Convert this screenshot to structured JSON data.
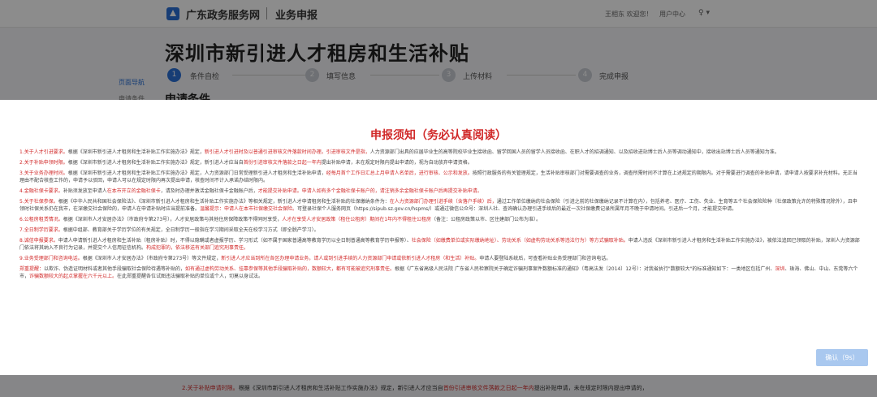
{
  "header": {
    "site_name": "广东政务服务网",
    "section": "业务申报",
    "welcome": "王相东 欢迎您！",
    "user_center": "用户中心",
    "user_icon": "♀ ▾"
  },
  "page": {
    "title": "深圳市新引进人才租房和生活补贴",
    "side_nav_label": "页面导航",
    "side_nav_item": "申请条件",
    "section_title": "申请条件",
    "steps": [
      {
        "num": "1",
        "label": "条件自检"
      },
      {
        "num": "2",
        "label": "填写信息"
      },
      {
        "num": "3",
        "label": "上传材料"
      },
      {
        "num": "4",
        "label": "完成申报"
      }
    ]
  },
  "modal": {
    "title": "申报须知（务必认真阅读）",
    "items": [
      {
        "parts": [
          {
            "t": "1.关于人才引进要求。",
            "red": true
          },
          {
            "t": "根据《深圳市新引进人才租房和生活补贴工作实施办法》规定，",
            "red": false
          },
          {
            "t": "新引进人才引进时及以普通引进审核文件落款时间办理。引进审核文件是指，",
            "red": true
          },
          {
            "t": "人力资源部门出具的应届毕业生的高等院校毕业生接收函、留学回国人员的留学人员接收函、在职人才的招调通知、以及招收进站博士后人员等调动通知中，接收出站博士后人员等通知为准。",
            "red": false
          }
        ]
      },
      {
        "parts": [
          {
            "t": "2.关于补贴申领时限。",
            "red": true
          },
          {
            "t": "根据《深圳市新引进人才租房和生活补贴工作实施办法》规定，新引进人才应当自",
            "red": false
          },
          {
            "t": "首份引进审核文件落款之日起一年内",
            "red": true
          },
          {
            "t": "提出补贴申请，未在规定时限内提出申请的，视为自动放弃申请资格。",
            "red": false
          }
        ]
      },
      {
        "parts": [
          {
            "t": "3.关于业务办理时间。",
            "red": true
          },
          {
            "t": "根据《深圳市新引进人才租房和生活补贴工作实施办法》规定，人力资源部门日常受理新引进人才租房和生活补贴申请，",
            "red": false
          },
          {
            "t": "经每月首个工作日汇总上月申请人名单后，进行审核、公示和发放。",
            "red": true
          },
          {
            "t": "按照行政服务的有关管理规定，生活补贴审核部门对需要调查的业务，调查所需时间不计算在上述规定的期限内。对于需要进行调查的补贴申请，请申请人按要求补充材料。",
            "red": false
          },
          {
            "t": "无正当理由不配合核查工作的，申请予以驳回，申请人可以在规定时限内再次提出申请，核查时间不计入承诺办结时限内。",
            "red": false
          }
        ]
      },
      {
        "parts": [
          {
            "t": "4.金融社保卡要求。",
            "red": true
          },
          {
            "t": "补贴须发放至申请人",
            "red": false
          },
          {
            "t": "在本市开立的金融社保卡",
            "red": true
          },
          {
            "t": "，请及时办理并激活金融社保卡金融账户后，",
            "red": false
          },
          {
            "t": "才能提交补贴申请。申请人如有多个金融社保卡账户的，请注销多余金融社保卡账户后再提交补贴申请。",
            "red": true
          }
        ]
      },
      {
        "parts": [
          {
            "t": "5.关于社保参保。",
            "red": true
          },
          {
            "t": "根据《中华人民共和国社会保险法》、《深圳市新引进人才租房和生活补贴工作实施办法》等相关规定，新引进人才申请租房和生活补贴的社保缴纳条件为：",
            "red": false
          },
          {
            "t": "在人力资源部门办理引进手续（含落户手续）后，",
            "red": true
          },
          {
            "t": "通过工作单位缴纳的社会保险（引进之前的社保缴纳记录不计算在内），包括养老、医疗、工伤、失业、生育等五个社会保险险种（社保政策允许的特殊情况除外），且申领时社保关系仍在我市，在深缴交社会保险的，申请人在申请补贴时应当提前准备。",
            "red": false
          },
          {
            "t": "温馨提示：申请人在本市社保缴交社会保险。",
            "red": true
          },
          {
            "t": "可登录社保个人服务网页（https://sipub.sz.gov.cn/hspms/）或通过微信公众号：深圳人社、查询确认办理引进手续后的最近一次社保缴费记录所属年月不晚于申请时间。引进后一个月，才能提交申请。",
            "red": false
          }
        ]
      },
      {
        "parts": [
          {
            "t": "6.公租房租赁情况。",
            "red": true
          },
          {
            "t": "根据《深圳市人才安居办法》（市政府令第273号），人才安居政策与其他住房保障政策不得同时享受，",
            "red": false
          },
          {
            "t": "人才在享受人才安居政策（租住公租房）期间在1年内不得租住公租房",
            "red": true
          },
          {
            "t": "（备注：公租房政策以市、区住建部门公布为准）。",
            "red": false
          }
        ]
      },
      {
        "parts": [
          {
            "t": "7.全日制学历要求。",
            "red": true
          },
          {
            "t": "根据中组部、教育部关于学历学位的有关规定，全日制学历一般指在学习期间采取全天在校学习方式（即全脱产学习）。",
            "red": false
          }
        ]
      },
      {
        "parts": [
          {
            "t": "8.诚信申报要求。",
            "red": true
          },
          {
            "t": "申请人申请新引进人才租房和生活补贴（租房补贴）时，不得以隐瞒或者虚报学历、学习形式（如不属于国家普通高等教育学历以全日制普通高等教育学历申报等）、",
            "red": false
          },
          {
            "t": "社会保险（如缴费单位或实际缴纳地址）、劳动关系（如虚构劳动关系等违法行为）等方式骗取补贴。",
            "red": true
          },
          {
            "t": "申请人违反《深圳市新引进人才租房和生活补贴工作实施办法》，被依法追回已领取的补贴，深圳人力资源部门依法将其纳入不良行为记录，并提交个人信用征信机构。",
            "red": false
          },
          {
            "t": "构成犯罪的，依法移送有关部门追究刑事责任。",
            "red": true
          }
        ]
      },
      {
        "parts": [
          {
            "t": "9.业务受理部门和咨询电话。",
            "red": true
          },
          {
            "t": "根据《深圳市人才安居办法》（市政府令第273号）等文件规定，",
            "red": false
          },
          {
            "t": "新引进人才应当到所在各区办理申请业务，请人或到引进手续的人力资源部门申请或依新引进人才租房（和生活）补贴。",
            "red": true
          },
          {
            "t": "申请人要登陆系统后，可查看补贴业务受理部门和咨询电话。",
            "red": false
          }
        ]
      },
      {
        "parts": [
          {
            "t": "郑重提醒：",
            "red": true
          },
          {
            "t": "以欺诈、伪造证明材料或者其他手段骗取社会保险待遇等补贴的，",
            "red": false
          },
          {
            "t": "如有通过虚构劳动关系、挂靠参保等其他手段骗取补贴的，数额较大，都有可能被追究刑事责任。",
            "red": true
          },
          {
            "t": "根据《广东省高级人民法院 广东省人民检察院关于确定诈骗刑事案件数额标准的通知》（粤高法发〔2014〕12号）：对我省执行\"数额较大\"的标准通知如下：一类地区包括广州、",
            "red": false
          },
          {
            "t": "深圳",
            "red": true
          },
          {
            "t": "、珠海、佛山、中山、东莞等六个市，",
            "red": false
          },
          {
            "t": "诈骗数额较大的起点掌握在六千元以上。",
            "red": true
          },
          {
            "t": "在此郑重提醒各位试图违法骗取补贴的单位或个人，切莫以身试法。",
            "red": false
          }
        ]
      }
    ],
    "confirm_button": "确认（9s）"
  },
  "bottom": {
    "parts": [
      {
        "t": "2.关于补贴申请时限。",
        "red": true
      },
      {
        "t": "根据《深圳市新引进人才租房和生活补贴工作实施办法》规定，新引进人才应当自",
        "red": false
      },
      {
        "t": "首份引进审核文件落款之日起一年内",
        "red": true
      },
      {
        "t": "提出补贴申请，未在规定时限内提出申请的，",
        "red": false
      }
    ]
  },
  "colors": {
    "accent": "#2a6fd6",
    "warning_red": "#d12a2a",
    "confirm_disabled": "#a9c8ef"
  }
}
